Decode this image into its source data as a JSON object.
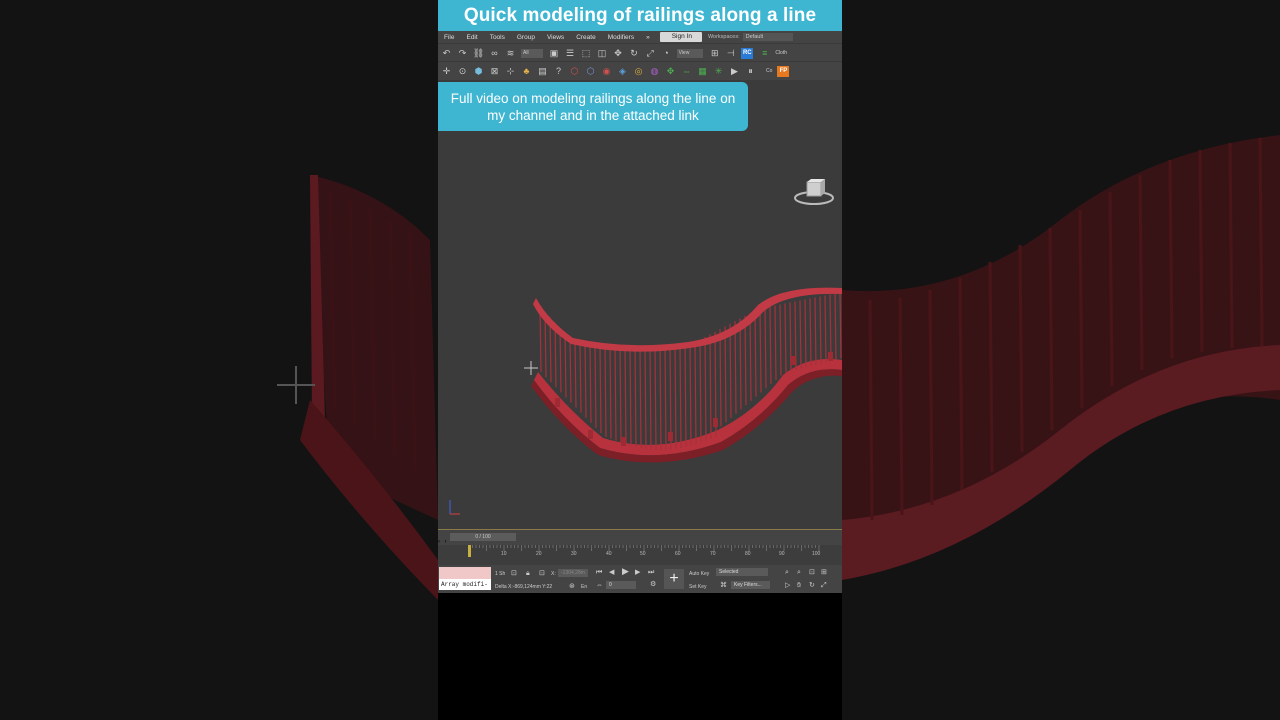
{
  "banner": {
    "title": "Quick modeling of railings along a line"
  },
  "menu": {
    "items": [
      "File",
      "Edit",
      "Tools",
      "Group",
      "Views",
      "Create",
      "Modifiers",
      "»"
    ],
    "sign_in": "Sign In",
    "workspaces_label": "Workspaces:",
    "workspaces_value": "Default"
  },
  "toolbar": {
    "selection_filter": "All",
    "view_dropdown": "View",
    "rc_label": "RC",
    "clone_label": "Cloth",
    "fp_label": "FP",
    "co_label": "Co"
  },
  "callout": {
    "text": "Full video on modeling railings along the line on my channel and in the attached link"
  },
  "timeline": {
    "frame_display": "0 / 100",
    "ruler_labels": [
      "10",
      "20",
      "30",
      "40",
      "50",
      "60",
      "70",
      "80",
      "90",
      "100"
    ]
  },
  "status": {
    "modifier_field": "Array modifi-",
    "selected_count": "1 Sh",
    "x_label": "X:",
    "x_value": "-1304,28m",
    "delta": "Delta X:-869,124mm  Y:22",
    "en_label": "En",
    "frame_value": "0",
    "auto_key": "Auto Key",
    "set_key": "Set Key",
    "selected_dropdown": "Selected",
    "key_filters": "Key Filters..."
  },
  "colors": {
    "banner": "#3fb6d1",
    "railing": "#c23a45",
    "viewport": "#3b3b3b",
    "ui_panel": "#444444"
  }
}
